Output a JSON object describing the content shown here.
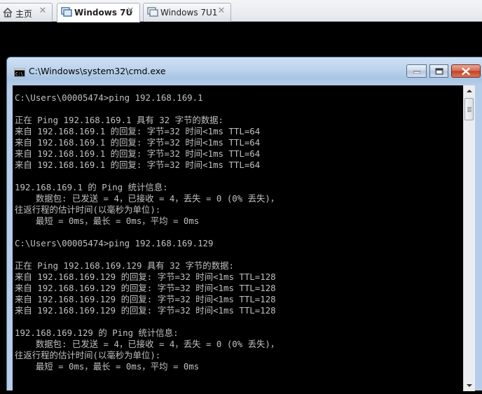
{
  "tabs": [
    {
      "label": "主页",
      "icon": "home-icon",
      "active": false
    },
    {
      "label": "Windows 7U",
      "icon": "vm-icon",
      "active": true
    },
    {
      "label": "Windows 7U1",
      "icon": "vm-icon",
      "active": false
    }
  ],
  "window": {
    "title": "C:\\Windows\\system32\\cmd.exe",
    "icon": "cmd-icon"
  },
  "console": {
    "lines": [
      "C:\\Users\\00005474>ping 192.168.169.1",
      "",
      "正在 Ping 192.168.169.1 具有 32 字节的数据:",
      "来自 192.168.169.1 的回复: 字节=32 时间<1ms TTL=64",
      "来自 192.168.169.1 的回复: 字节=32 时间<1ms TTL=64",
      "来自 192.168.169.1 的回复: 字节=32 时间<1ms TTL=64",
      "来自 192.168.169.1 的回复: 字节=32 时间<1ms TTL=64",
      "",
      "192.168.169.1 的 Ping 统计信息:",
      "    数据包: 已发送 = 4，已接收 = 4，丢失 = 0 (0% 丢失)，",
      "往返行程的估计时间(以毫秒为单位):",
      "    最短 = 0ms，最长 = 0ms，平均 = 0ms",
      "",
      "C:\\Users\\00005474>ping 192.168.169.129",
      "",
      "正在 Ping 192.168.169.129 具有 32 字节的数据:",
      "来自 192.168.169.129 的回复: 字节=32 时间<1ms TTL=128",
      "来自 192.168.169.129 的回复: 字节=32 时间<1ms TTL=128",
      "来自 192.168.169.129 的回复: 字节=32 时间<1ms TTL=128",
      "来自 192.168.169.129 的回复: 字节=32 时间<1ms TTL=128",
      "",
      "192.168.169.129 的 Ping 统计信息:",
      "    数据包: 已发送 = 4，已接收 = 4，丢失 = 0 (0% 丢失)，",
      "往返行程的估计时间(以毫秒为单位):",
      "    最短 = 0ms，最长 = 0ms，平均 = 0ms"
    ]
  },
  "colors": {
    "console_background": "#000000",
    "console_text": "#c0c0c0",
    "close_button": "#c2401f"
  }
}
